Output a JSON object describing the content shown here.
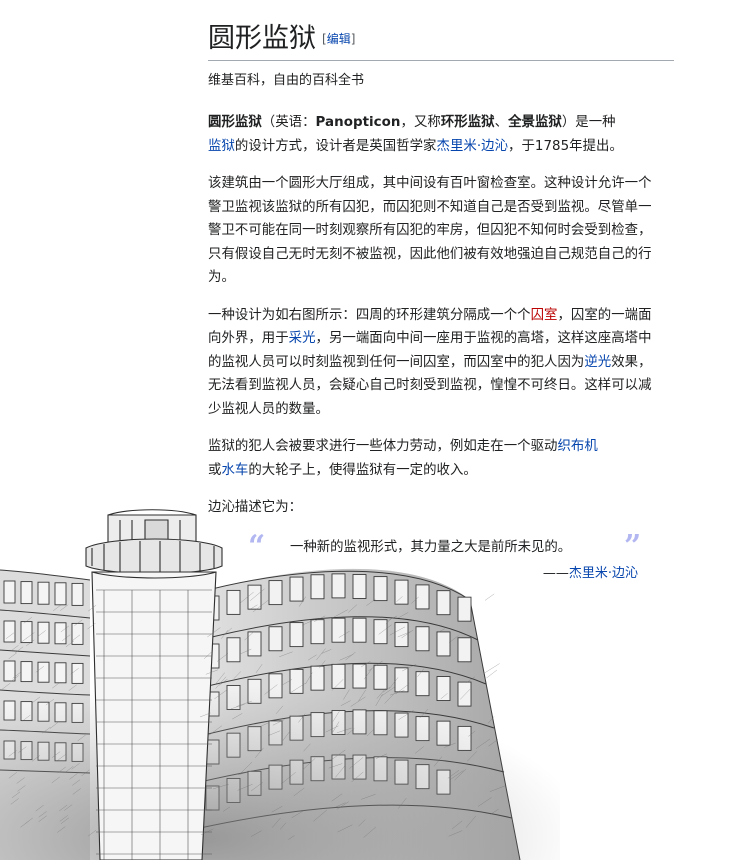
{
  "title": "圆形监狱",
  "edit_label": "编辑",
  "tagline": "维基百科，自由的百科全书",
  "para1": {
    "term": "圆形监狱",
    "t1": "（英语：",
    "english": "Panopticon",
    "t2": "，又称",
    "alt1": "环形监狱",
    "t3": "、",
    "alt2": "全景监狱",
    "t4": "）是一种",
    "link_prison": "监狱",
    "t5": "的设计方式，设计者是英国哲学家",
    "link_bentham": "杰里米·边沁",
    "t6": "，于1785年提出。"
  },
  "para2": "该建筑由一个圆形大厅组成，其中间设有百叶窗检查室。这种设计允许一个警卫监视该监狱的所有囚犯，而囚犯则不知道自己是否受到监视。尽管单一警卫不可能在同一时刻观察所有囚犯的牢房，但囚犯不知何时会受到检查，只有假设自己无时无刻不被监视，因此他们被有效地强迫自己规范自己的行为。",
  "para3": {
    "t1": "一种设计为如右图所示：四周的环形建筑分隔成一个个",
    "link_cell": "囚室",
    "t2": "，囚室的一端面向外界，用于",
    "link_light": "采光",
    "t3": "，另一端面向中间一座用于监视的高塔，这样这座高塔中的监视人员可以时刻监视到任何一间囚室，而囚室中的犯人因为",
    "link_backlight": "逆光",
    "t4": "效果，无法看到监视人员，会疑心自己时刻受到监视，惶惶不可终日。这样可以减少监视人员的数量。"
  },
  "para4": {
    "t1": "监狱的犯人会被要求进行一些体力劳动，例如走在一个驱动",
    "link_loom": "织布机",
    "t2": "或",
    "link_waterwheel": "水车",
    "t3": "的大轮子上，使得监狱有一定的收入。"
  },
  "para5": "边沁描述它为：",
  "quote": {
    "open_mark": "“",
    "text": "一种新的监视形式，其力量之大是前所未见的。",
    "close_mark": "”",
    "cite_prefix": "——",
    "cite_link": "杰里米·边沁"
  },
  "illustration": {
    "name": "panopticon-sketch",
    "colors": {
      "ink": "#3a3a3a",
      "shade": "#9a9a9a"
    }
  },
  "colors": {
    "link": "#0645ad",
    "new_link": "#ba0000",
    "text": "#202122",
    "quote_mark": "#b2b7f2"
  }
}
